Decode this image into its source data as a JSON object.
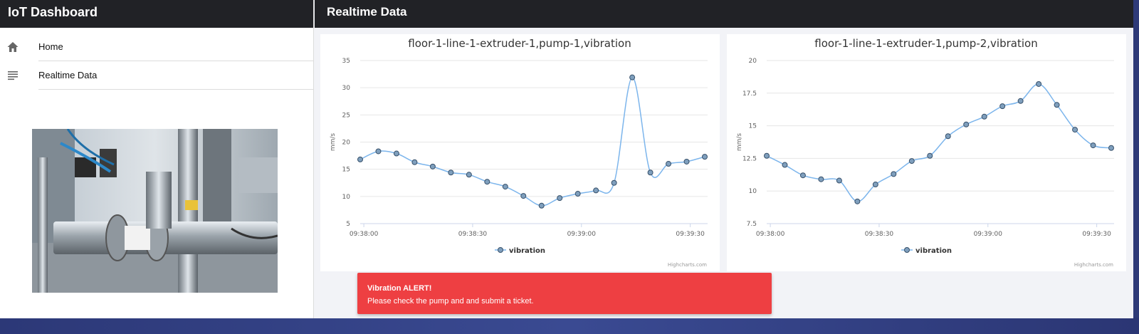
{
  "sidebar": {
    "title": "IoT Dashboard",
    "items": [
      {
        "label": "Home",
        "icon": "home-icon"
      },
      {
        "label": "Realtime Data",
        "icon": "list-icon"
      }
    ],
    "image": "industrial-pipes-photo"
  },
  "main": {
    "title": "Realtime Data",
    "alert": {
      "title": "Vibration ALERT!",
      "message": "Please check the pump and and submit a ticket."
    }
  },
  "colors": {
    "header_bg": "#212226",
    "series": "#7cb5ec",
    "alert_bg": "#ee3f42"
  },
  "chart_data": [
    {
      "type": "line",
      "title": "floor-1-line-1-extruder-1,pump-1,vibration",
      "ylabel": "mm/s",
      "xlabel": "",
      "ylim": [
        5,
        35
      ],
      "yticks": [
        "5",
        "10",
        "15",
        "20",
        "25",
        "30",
        "35"
      ],
      "xticks": [
        "09:38:00",
        "09:38:30",
        "09:39:00",
        "09:39:30"
      ],
      "x": [
        "09:37:59",
        "09:38:04",
        "09:38:09",
        "09:38:14",
        "09:38:19",
        "09:38:24",
        "09:38:29",
        "09:38:34",
        "09:38:39",
        "09:38:44",
        "09:38:49",
        "09:38:54",
        "09:38:59",
        "09:39:04",
        "09:39:09",
        "09:39:14",
        "09:39:19",
        "09:39:24",
        "09:39:29"
      ],
      "series": [
        {
          "name": "vibration",
          "values": [
            16.8,
            18.3,
            17.9,
            16.3,
            15.5,
            14.4,
            14.0,
            12.7,
            11.8,
            10.1,
            8.3,
            9.7,
            10.5,
            11.1,
            12.5,
            31.9,
            14.4,
            16.0,
            16.4,
            17.3
          ]
        }
      ],
      "legend": "bottom-center",
      "grid": true,
      "credit": "Highcharts.com"
    },
    {
      "type": "line",
      "title": "floor-1-line-1-extruder-1,pump-2,vibration",
      "ylabel": "mm/s",
      "xlabel": "",
      "ylim": [
        7.5,
        20
      ],
      "yticks": [
        "7.5",
        "10",
        "12.5",
        "15",
        "17.5",
        "20"
      ],
      "xticks": [
        "09:38:00",
        "09:38:30",
        "09:39:00",
        "09:39:30"
      ],
      "series": [
        {
          "name": "vibration",
          "values": [
            12.7,
            12.0,
            11.2,
            10.9,
            10.8,
            9.2,
            10.5,
            11.3,
            12.3,
            12.7,
            14.2,
            15.1,
            15.7,
            16.5,
            16.9,
            18.2,
            16.6,
            14.7,
            13.5,
            13.3
          ]
        }
      ],
      "legend": "bottom-center",
      "grid": true,
      "credit": "Highcharts.com"
    }
  ]
}
